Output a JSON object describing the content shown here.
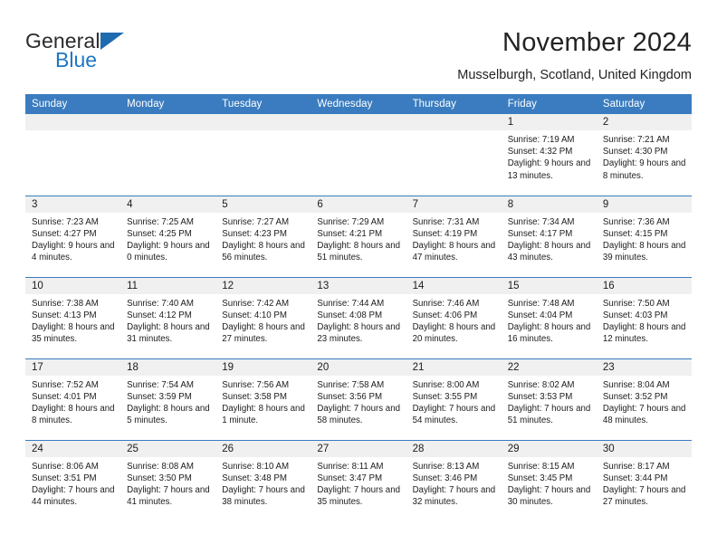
{
  "brand": {
    "name_top": "General",
    "name_bottom": "Blue",
    "accent_color": "#1f76c4"
  },
  "header": {
    "title": "November 2024",
    "subtitle": "Musselburgh, Scotland, United Kingdom"
  },
  "colors": {
    "header_row_bg": "#3a7cbf",
    "daynum_band_bg": "#f0f0f0",
    "row_divider": "#3a7cbf",
    "text": "#1c1c1c"
  },
  "weekday_headers": [
    "Sunday",
    "Monday",
    "Tuesday",
    "Wednesday",
    "Thursday",
    "Friday",
    "Saturday"
  ],
  "weeks": [
    [
      {
        "day": "",
        "empty": true
      },
      {
        "day": "",
        "empty": true
      },
      {
        "day": "",
        "empty": true
      },
      {
        "day": "",
        "empty": true
      },
      {
        "day": "",
        "empty": true
      },
      {
        "day": "1",
        "sunrise": "Sunrise: 7:19 AM",
        "sunset": "Sunset: 4:32 PM",
        "daylight": "Daylight: 9 hours and 13 minutes."
      },
      {
        "day": "2",
        "sunrise": "Sunrise: 7:21 AM",
        "sunset": "Sunset: 4:30 PM",
        "daylight": "Daylight: 9 hours and 8 minutes."
      }
    ],
    [
      {
        "day": "3",
        "sunrise": "Sunrise: 7:23 AM",
        "sunset": "Sunset: 4:27 PM",
        "daylight": "Daylight: 9 hours and 4 minutes."
      },
      {
        "day": "4",
        "sunrise": "Sunrise: 7:25 AM",
        "sunset": "Sunset: 4:25 PM",
        "daylight": "Daylight: 9 hours and 0 minutes."
      },
      {
        "day": "5",
        "sunrise": "Sunrise: 7:27 AM",
        "sunset": "Sunset: 4:23 PM",
        "daylight": "Daylight: 8 hours and 56 minutes."
      },
      {
        "day": "6",
        "sunrise": "Sunrise: 7:29 AM",
        "sunset": "Sunset: 4:21 PM",
        "daylight": "Daylight: 8 hours and 51 minutes."
      },
      {
        "day": "7",
        "sunrise": "Sunrise: 7:31 AM",
        "sunset": "Sunset: 4:19 PM",
        "daylight": "Daylight: 8 hours and 47 minutes."
      },
      {
        "day": "8",
        "sunrise": "Sunrise: 7:34 AM",
        "sunset": "Sunset: 4:17 PM",
        "daylight": "Daylight: 8 hours and 43 minutes."
      },
      {
        "day": "9",
        "sunrise": "Sunrise: 7:36 AM",
        "sunset": "Sunset: 4:15 PM",
        "daylight": "Daylight: 8 hours and 39 minutes."
      }
    ],
    [
      {
        "day": "10",
        "sunrise": "Sunrise: 7:38 AM",
        "sunset": "Sunset: 4:13 PM",
        "daylight": "Daylight: 8 hours and 35 minutes."
      },
      {
        "day": "11",
        "sunrise": "Sunrise: 7:40 AM",
        "sunset": "Sunset: 4:12 PM",
        "daylight": "Daylight: 8 hours and 31 minutes."
      },
      {
        "day": "12",
        "sunrise": "Sunrise: 7:42 AM",
        "sunset": "Sunset: 4:10 PM",
        "daylight": "Daylight: 8 hours and 27 minutes."
      },
      {
        "day": "13",
        "sunrise": "Sunrise: 7:44 AM",
        "sunset": "Sunset: 4:08 PM",
        "daylight": "Daylight: 8 hours and 23 minutes."
      },
      {
        "day": "14",
        "sunrise": "Sunrise: 7:46 AM",
        "sunset": "Sunset: 4:06 PM",
        "daylight": "Daylight: 8 hours and 20 minutes."
      },
      {
        "day": "15",
        "sunrise": "Sunrise: 7:48 AM",
        "sunset": "Sunset: 4:04 PM",
        "daylight": "Daylight: 8 hours and 16 minutes."
      },
      {
        "day": "16",
        "sunrise": "Sunrise: 7:50 AM",
        "sunset": "Sunset: 4:03 PM",
        "daylight": "Daylight: 8 hours and 12 minutes."
      }
    ],
    [
      {
        "day": "17",
        "sunrise": "Sunrise: 7:52 AM",
        "sunset": "Sunset: 4:01 PM",
        "daylight": "Daylight: 8 hours and 8 minutes."
      },
      {
        "day": "18",
        "sunrise": "Sunrise: 7:54 AM",
        "sunset": "Sunset: 3:59 PM",
        "daylight": "Daylight: 8 hours and 5 minutes."
      },
      {
        "day": "19",
        "sunrise": "Sunrise: 7:56 AM",
        "sunset": "Sunset: 3:58 PM",
        "daylight": "Daylight: 8 hours and 1 minute."
      },
      {
        "day": "20",
        "sunrise": "Sunrise: 7:58 AM",
        "sunset": "Sunset: 3:56 PM",
        "daylight": "Daylight: 7 hours and 58 minutes."
      },
      {
        "day": "21",
        "sunrise": "Sunrise: 8:00 AM",
        "sunset": "Sunset: 3:55 PM",
        "daylight": "Daylight: 7 hours and 54 minutes."
      },
      {
        "day": "22",
        "sunrise": "Sunrise: 8:02 AM",
        "sunset": "Sunset: 3:53 PM",
        "daylight": "Daylight: 7 hours and 51 minutes."
      },
      {
        "day": "23",
        "sunrise": "Sunrise: 8:04 AM",
        "sunset": "Sunset: 3:52 PM",
        "daylight": "Daylight: 7 hours and 48 minutes."
      }
    ],
    [
      {
        "day": "24",
        "sunrise": "Sunrise: 8:06 AM",
        "sunset": "Sunset: 3:51 PM",
        "daylight": "Daylight: 7 hours and 44 minutes."
      },
      {
        "day": "25",
        "sunrise": "Sunrise: 8:08 AM",
        "sunset": "Sunset: 3:50 PM",
        "daylight": "Daylight: 7 hours and 41 minutes."
      },
      {
        "day": "26",
        "sunrise": "Sunrise: 8:10 AM",
        "sunset": "Sunset: 3:48 PM",
        "daylight": "Daylight: 7 hours and 38 minutes."
      },
      {
        "day": "27",
        "sunrise": "Sunrise: 8:11 AM",
        "sunset": "Sunset: 3:47 PM",
        "daylight": "Daylight: 7 hours and 35 minutes."
      },
      {
        "day": "28",
        "sunrise": "Sunrise: 8:13 AM",
        "sunset": "Sunset: 3:46 PM",
        "daylight": "Daylight: 7 hours and 32 minutes."
      },
      {
        "day": "29",
        "sunrise": "Sunrise: 8:15 AM",
        "sunset": "Sunset: 3:45 PM",
        "daylight": "Daylight: 7 hours and 30 minutes."
      },
      {
        "day": "30",
        "sunrise": "Sunrise: 8:17 AM",
        "sunset": "Sunset: 3:44 PM",
        "daylight": "Daylight: 7 hours and 27 minutes."
      }
    ]
  ]
}
